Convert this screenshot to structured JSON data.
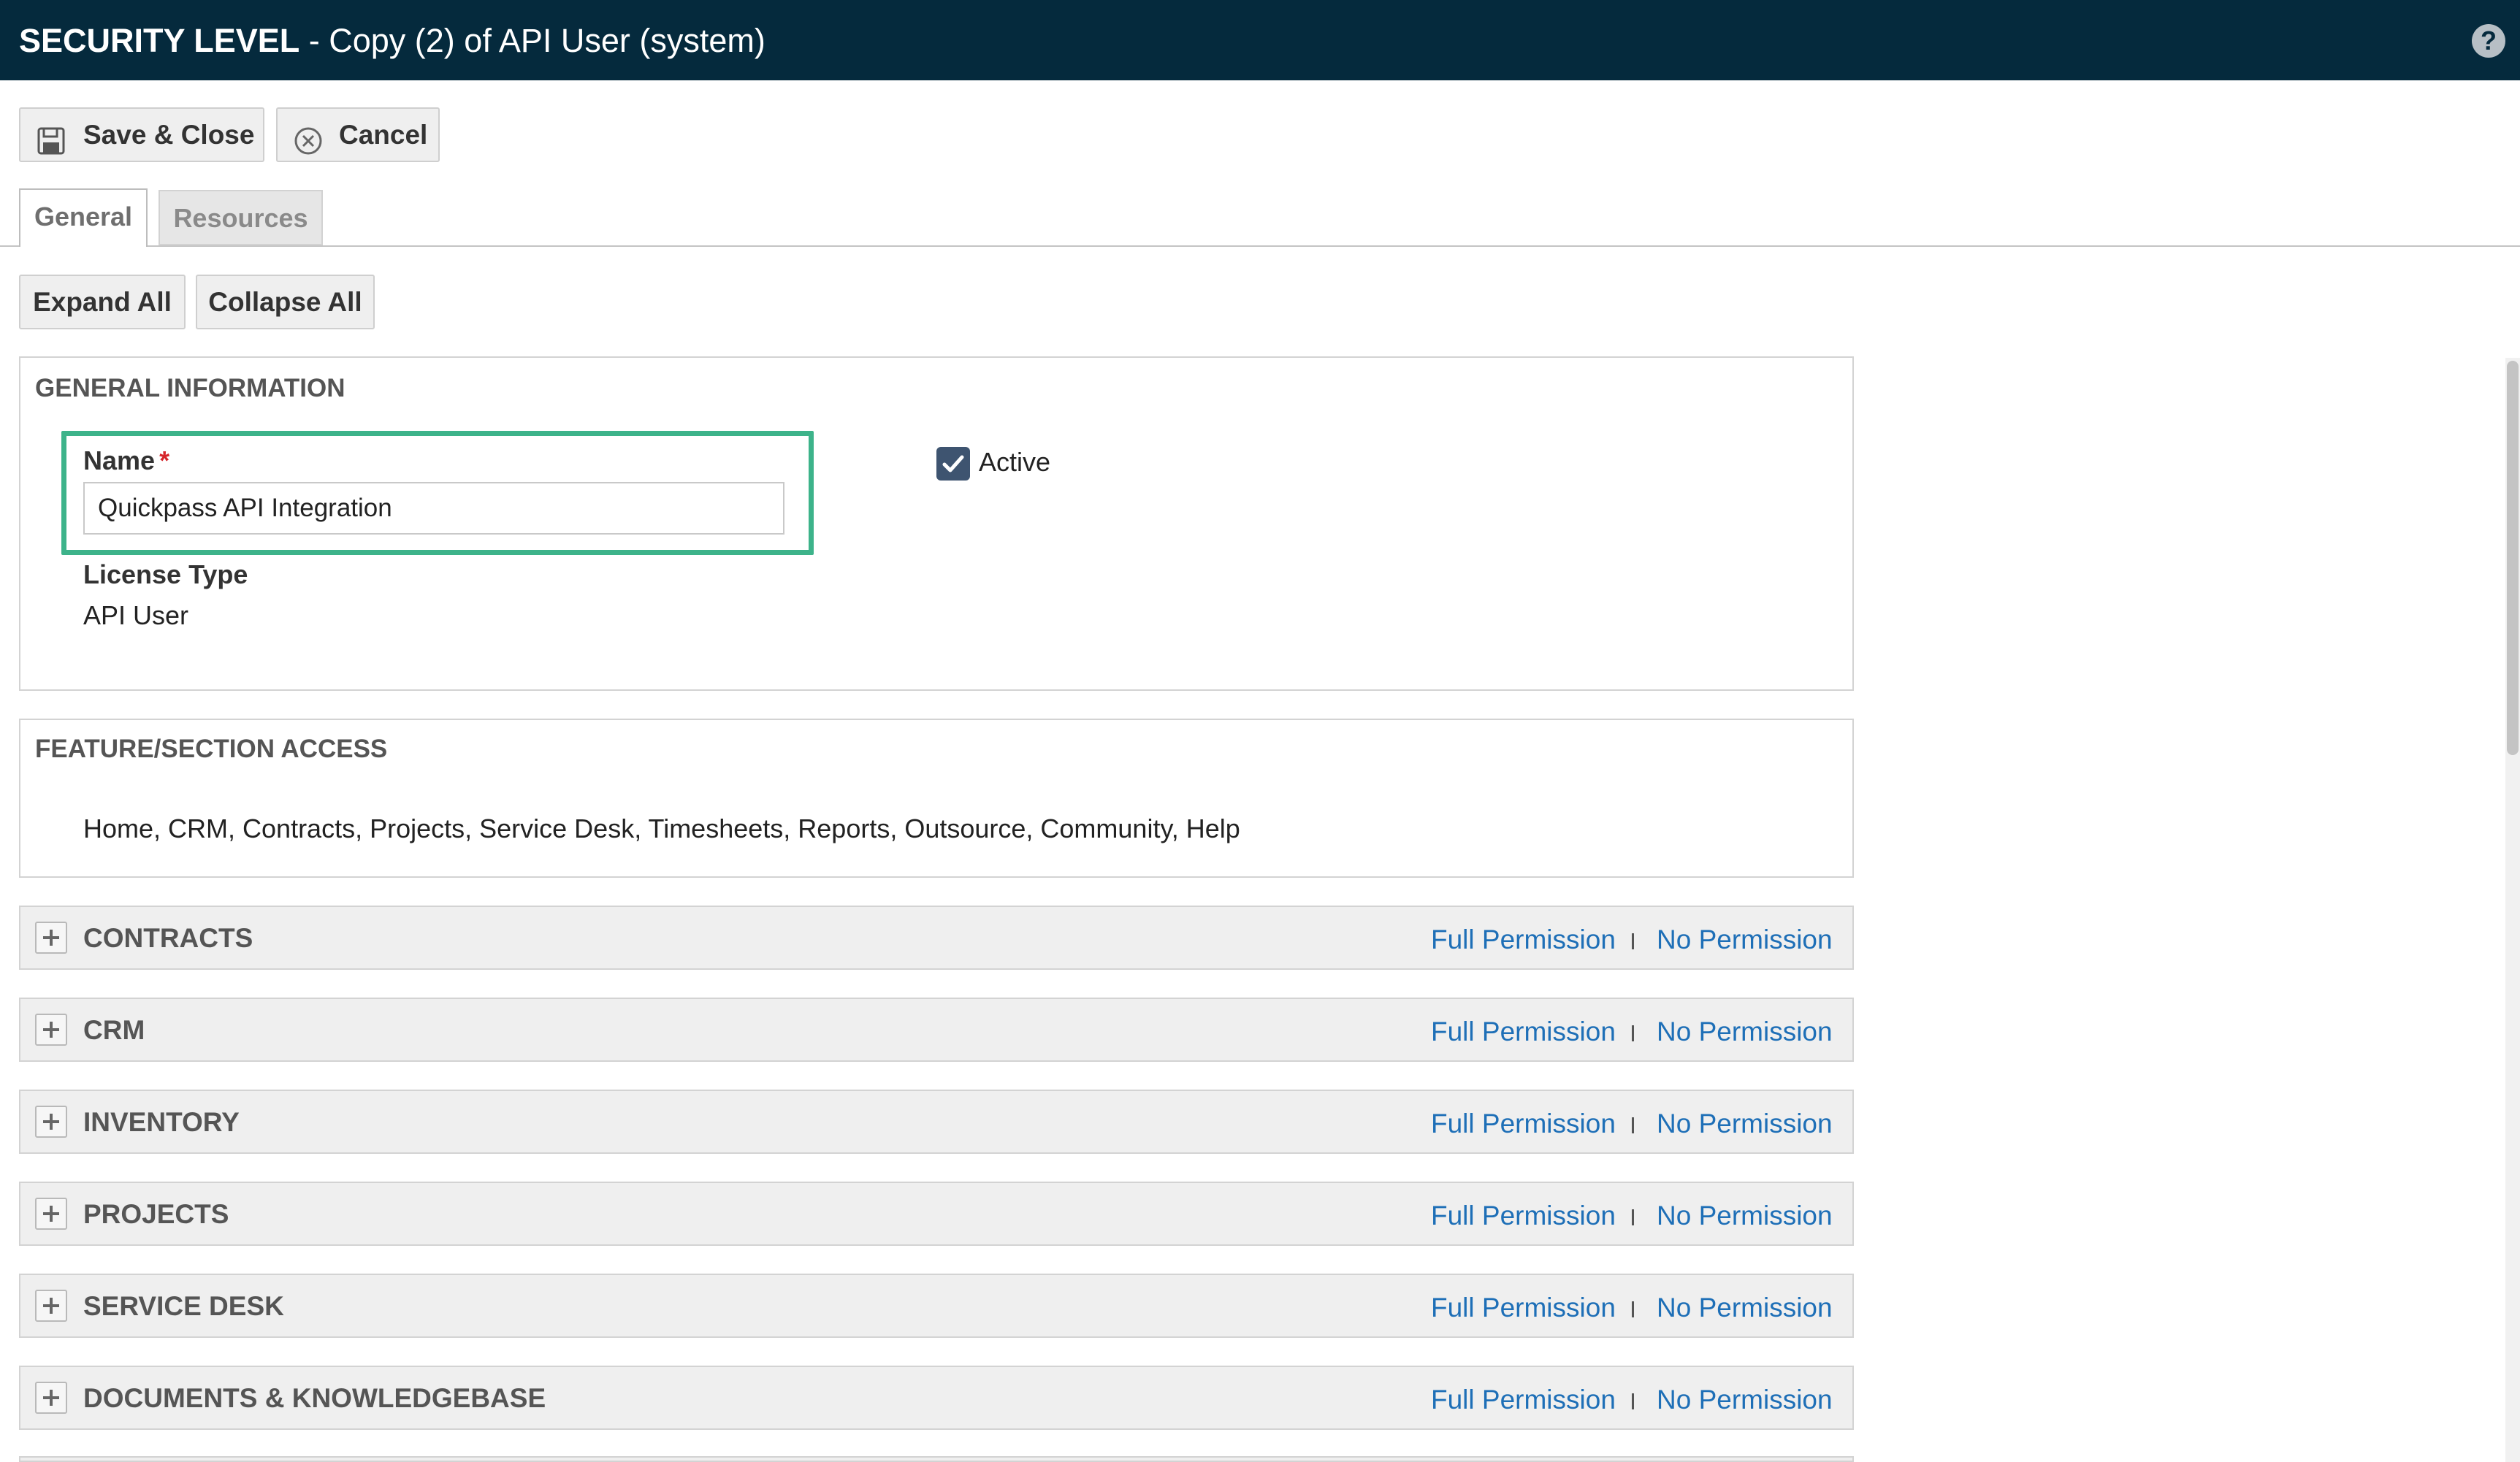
{
  "window": {
    "title_prefix": "SECURITY LEVEL",
    "title_rest": " - Copy (2) of API User (system)",
    "help_glyph": "?"
  },
  "toolbar": {
    "save_close_label": "Save & Close",
    "cancel_label": "Cancel"
  },
  "tabs": [
    {
      "label": "General",
      "active": true
    },
    {
      "label": "Resources",
      "active": false
    }
  ],
  "actions": {
    "expand_all_label": "Expand All",
    "collapse_all_label": "Collapse All"
  },
  "general_info": {
    "heading": "GENERAL INFORMATION",
    "name_label": "Name",
    "required_marker": "*",
    "name_value": "Quickpass API Integration",
    "active_label": "Active",
    "active_checked": true,
    "license_type_label": "License Type",
    "license_type_value": "API User"
  },
  "feature_access": {
    "heading": "FEATURE/SECTION ACCESS",
    "items_text": "Home, CRM, Contracts, Projects, Service Desk, Timesheets, Reports, Outsource, Community, Help"
  },
  "sections": [
    {
      "title": "CONTRACTS",
      "full_permission": "Full Permission",
      "no_permission": "No Permission"
    },
    {
      "title": "CRM",
      "full_permission": "Full Permission",
      "no_permission": "No Permission"
    },
    {
      "title": "INVENTORY",
      "full_permission": "Full Permission",
      "no_permission": "No Permission"
    },
    {
      "title": "PROJECTS",
      "full_permission": "Full Permission",
      "no_permission": "No Permission"
    },
    {
      "title": "SERVICE DESK",
      "full_permission": "Full Permission",
      "no_permission": "No Permission"
    },
    {
      "title": "DOCUMENTS & KNOWLEDGEBASE",
      "full_permission": "Full Permission",
      "no_permission": "No Permission"
    }
  ],
  "colors": {
    "titlebar": "#052a3d",
    "link": "#1e6fb7",
    "highlight": "#3db38a",
    "required": "#d6252b",
    "checkbox": "#3e5470"
  }
}
